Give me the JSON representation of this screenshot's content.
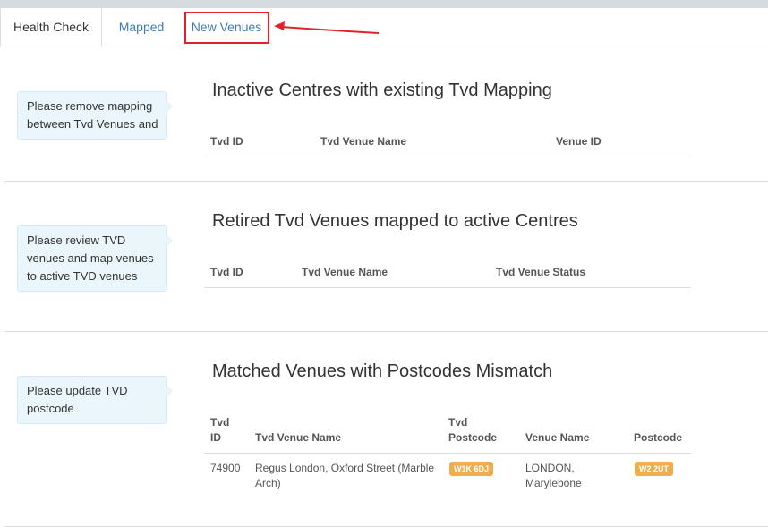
{
  "tabs": {
    "health_check": "Health Check",
    "mapped": "Mapped",
    "new_venues": "New Venues"
  },
  "sections": {
    "inactive": {
      "note": "Please remove mapping between Tvd Venues and",
      "title": "Inactive Centres with existing Tvd Mapping",
      "columns": [
        "Tvd ID",
        "Tvd Venue Name",
        "Venue ID"
      ]
    },
    "retired": {
      "note": "Please review TVD venues and map venues to active TVD venues",
      "title": "Retired Tvd Venues mapped to active Centres",
      "columns": [
        "Tvd ID",
        "Tvd Venue Name",
        "Tvd Venue Status"
      ]
    },
    "mismatch": {
      "note": "Please update TVD postcode",
      "title": "Matched Venues with Postcodes Mismatch",
      "columns": [
        "Tvd ID",
        "Tvd Venue Name",
        "Tvd Postcode",
        "Venue Name",
        "Postcode"
      ],
      "rows": [
        {
          "tvd_id": "74900",
          "tvd_venue_name": "Regus London, Oxford Street (Marble Arch)",
          "tvd_postcode": "W1K 6DJ",
          "venue_name": "LONDON, Marylebone",
          "postcode": "W2 2UT"
        }
      ]
    }
  },
  "colors": {
    "link": "#3f7cae",
    "highlight": "#e0232b",
    "badge": "#f0ad4e",
    "note_bg": "#eaf6fb"
  }
}
